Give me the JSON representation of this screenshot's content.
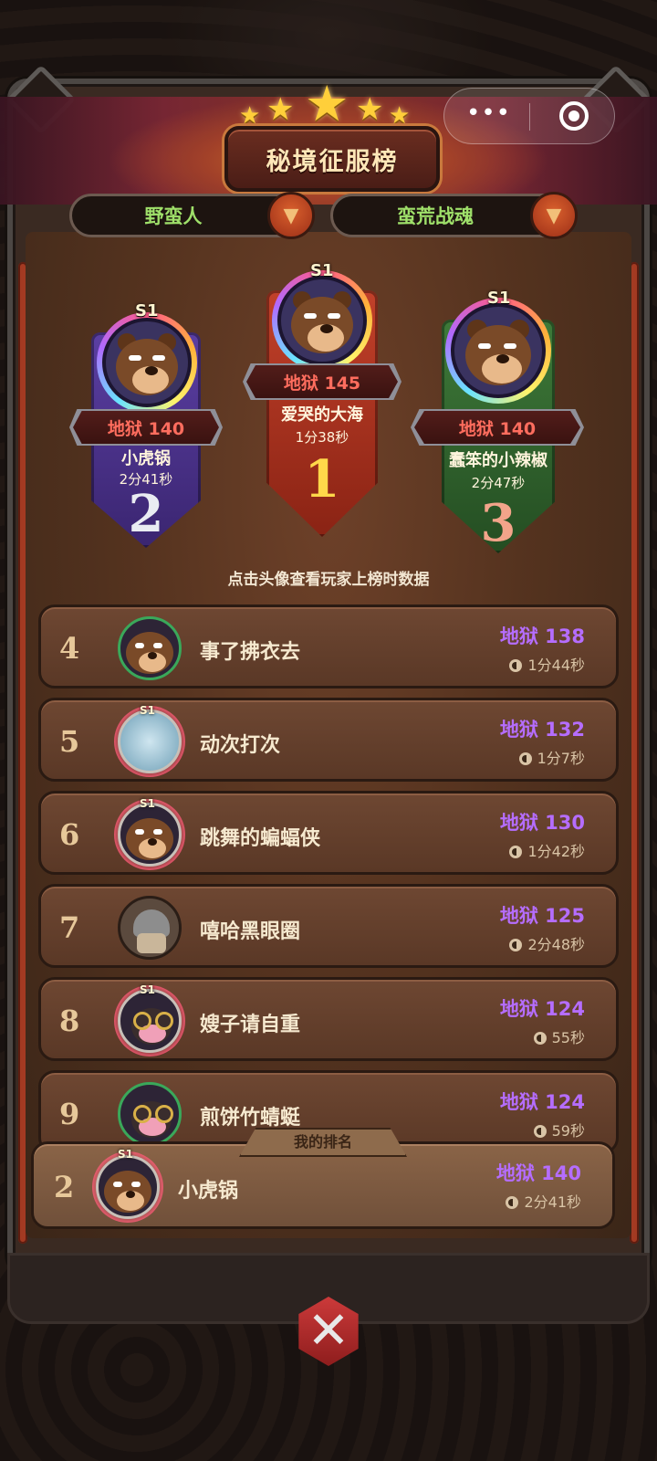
{
  "header": {
    "title": "秘境征服榜",
    "class_selector": "野蛮人",
    "build_selector": "蛮荒战魂"
  },
  "top3": [
    {
      "rank": "1",
      "season": "S1",
      "score": "地狱 145",
      "name": "爱哭的大海",
      "time": "1分38秒",
      "color": "#b9331d"
    },
    {
      "rank": "2",
      "season": "S1",
      "score": "地狱 140",
      "name": "小虎锅",
      "time": "2分41秒",
      "color": "#4a2f8a"
    },
    {
      "rank": "3",
      "season": "S1",
      "score": "地狱 140",
      "name": "蠢笨的小辣椒",
      "time": "2分47秒",
      "color": "#2f5a2c"
    }
  ],
  "hint": "点击头像查看玩家上榜时数据",
  "list": [
    {
      "rank": "4",
      "name": "事了拂衣去",
      "score": "地狱 138",
      "time": "1分44秒",
      "season": ""
    },
    {
      "rank": "5",
      "name": "动次打次",
      "score": "地狱 132",
      "time": "1分7秒",
      "season": "S1"
    },
    {
      "rank": "6",
      "name": "跳舞的蝙蝠侠",
      "score": "地狱 130",
      "time": "1分42秒",
      "season": "S1"
    },
    {
      "rank": "7",
      "name": "嘻哈黑眼圈",
      "score": "地狱 125",
      "time": "2分48秒",
      "season": ""
    },
    {
      "rank": "8",
      "name": "嫂子请自重",
      "score": "地狱 124",
      "time": "55秒",
      "season": "S1"
    },
    {
      "rank": "9",
      "name": "煎饼竹蜻蜓",
      "score": "地狱 124",
      "time": "59秒",
      "season": ""
    }
  ],
  "my_rank": {
    "label": "我的排名",
    "rank": "2",
    "season": "S1",
    "name": "小虎锅",
    "score": "地狱 140",
    "time": "2分41秒"
  },
  "capsule": {
    "more": "•••"
  },
  "close_icon": "✕",
  "arrow_icon": "▼"
}
